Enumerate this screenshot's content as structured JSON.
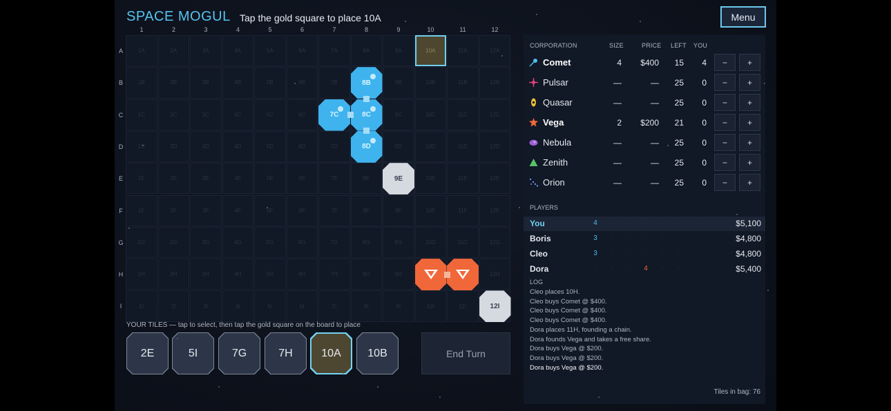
{
  "title": "SPACE MOGUL",
  "instruction": "Tap the gold square to place 10A",
  "menu_label": "Menu",
  "board": {
    "columns": [
      "1",
      "2",
      "3",
      "4",
      "5",
      "6",
      "7",
      "8",
      "9",
      "10",
      "11",
      "12"
    ],
    "rows": [
      "A",
      "B",
      "C",
      "D",
      "E",
      "F",
      "G",
      "H",
      "I"
    ],
    "target_cell": "10A",
    "placed_tiles": [
      {
        "id": "8B",
        "owner": "comet",
        "label": "8B"
      },
      {
        "id": "7C",
        "owner": "comet",
        "label": "7C"
      },
      {
        "id": "8C",
        "owner": "comet",
        "label": "8C"
      },
      {
        "id": "8D",
        "owner": "comet",
        "label": "8D"
      },
      {
        "id": "9E",
        "owner": "neutral",
        "label": "9E"
      },
      {
        "id": "10H",
        "owner": "vega",
        "label": ""
      },
      {
        "id": "11H",
        "owner": "vega",
        "label": ""
      },
      {
        "id": "12I",
        "owner": "neutral",
        "label": "12I"
      }
    ]
  },
  "hand": {
    "label": "YOUR TILES — tap to select, then tap the gold square on the board to place",
    "tiles": [
      "2E",
      "5I",
      "7G",
      "7H",
      "10A",
      "10B"
    ],
    "selected": "10A"
  },
  "end_turn_label": "End Turn",
  "corporations": {
    "headers": {
      "corporation": "CORPORATION",
      "size": "SIZE",
      "price": "PRICE",
      "left": "LEFT",
      "you": "YOU"
    },
    "rows": [
      {
        "name": "Comet",
        "icon": "comet-icon",
        "color": "#4fbdf0",
        "size": "4",
        "price": "$400",
        "left": "15",
        "you": "4",
        "active": true
      },
      {
        "name": "Pulsar",
        "icon": "pulsar-icon",
        "color": "#e0457a",
        "size": "—",
        "price": "—",
        "left": "25",
        "you": "0",
        "active": false
      },
      {
        "name": "Quasar",
        "icon": "quasar-icon",
        "color": "#e8c132",
        "size": "—",
        "price": "—",
        "left": "25",
        "you": "0",
        "active": false
      },
      {
        "name": "Vega",
        "icon": "vega-star-icon",
        "color": "#f0673a",
        "size": "2",
        "price": "$200",
        "left": "21",
        "you": "0",
        "active": true
      },
      {
        "name": "Nebula",
        "icon": "nebula-icon",
        "color": "#9b5fd1",
        "size": "—",
        "price": "—",
        "left": "25",
        "you": "0",
        "active": false
      },
      {
        "name": "Zenith",
        "icon": "zenith-triangle-icon",
        "color": "#58c26a",
        "size": "—",
        "price": "—",
        "left": "25",
        "you": "0",
        "active": false
      },
      {
        "name": "Orion",
        "icon": "orion-icon",
        "color": "#6c8ef0",
        "size": "—",
        "price": "—",
        "left": "25",
        "you": "0",
        "active": false
      }
    ],
    "minus_label": "−",
    "plus_label": "+"
  },
  "players": {
    "label": "PLAYERS",
    "rows": [
      {
        "name": "You",
        "holdings": [
          "4",
          "·",
          "·",
          "·",
          "·",
          "·",
          "·"
        ],
        "cash": "$5,100",
        "me": true
      },
      {
        "name": "Boris",
        "holdings": [
          "3",
          "·",
          "·",
          "·",
          "·",
          "·",
          "·"
        ],
        "cash": "$4,800",
        "me": false
      },
      {
        "name": "Cleo",
        "holdings": [
          "3",
          "·",
          "·",
          "·",
          "·",
          "·",
          "·"
        ],
        "cash": "$4,800",
        "me": false
      },
      {
        "name": "Dora",
        "holdings": [
          "·",
          "·",
          "·",
          "4",
          "·",
          "·",
          "·"
        ],
        "cash": "$5,400",
        "me": false
      }
    ]
  },
  "log": {
    "label": "LOG",
    "entries": [
      "Cleo places 10H.",
      "Cleo buys Comet @ $400.",
      "Cleo buys Comet @ $400.",
      "Cleo buys Comet @ $400.",
      "Dora places 11H, founding a chain.",
      "Dora founds Vega and takes a free share.",
      "Dora buys Vega @ $200.",
      "Dora buys Vega @ $200.",
      "Dora buys Vega @ $200."
    ]
  },
  "tiles_in_bag": "Tiles in bag: 76"
}
